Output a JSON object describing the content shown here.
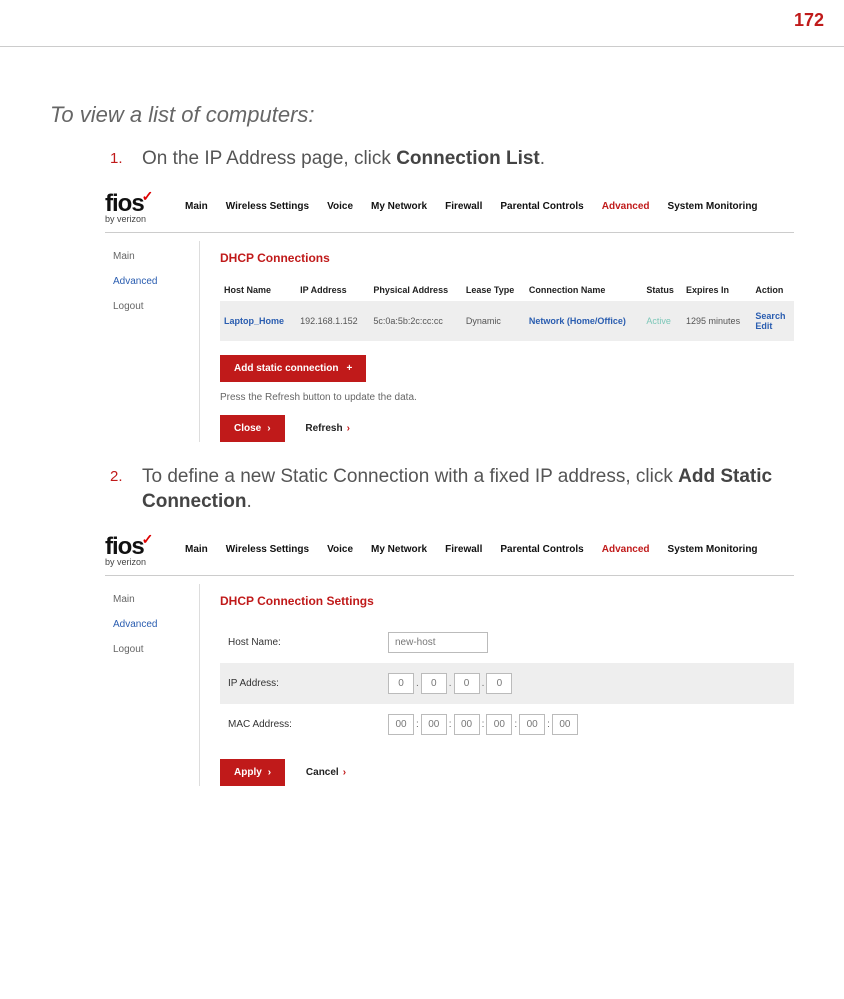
{
  "page_number": "172",
  "section_title": "To view a list of computers:",
  "step1": {
    "num": "1.",
    "text_prefix": "On the IP Address page, click ",
    "text_bold": "Connection List",
    "text_suffix": "."
  },
  "step2": {
    "num": "2.",
    "text_prefix": "To define a new Static Connection with a fixed IP address, click ",
    "text_bold": "Add Static Connection",
    "text_suffix": "."
  },
  "fios": {
    "logo_word": "fios",
    "logo_check": "✓",
    "by": "by verizon",
    "nav": [
      "Main",
      "Wireless Settings",
      "Voice",
      "My Network",
      "Firewall",
      "Parental Controls",
      "Advanced",
      "System Monitoring"
    ],
    "nav_active": "Advanced",
    "sidebar": [
      "Main",
      "Advanced",
      "Logout"
    ],
    "sidebar_active": "Advanced"
  },
  "shot1": {
    "title": "DHCP Connections",
    "headers": [
      "Host Name",
      "IP Address",
      "Physical Address",
      "Lease Type",
      "Connection Name",
      "Status",
      "Expires In",
      "Action"
    ],
    "row": {
      "host": "Laptop_Home",
      "ip": "192.168.1.152",
      "phys": "5c:0a:5b:2c:cc:cc",
      "lease": "Dynamic",
      "conn": "Network (Home/Office)",
      "status": "Active",
      "expires": "1295 minutes",
      "action1": "Search",
      "action2": "Edit"
    },
    "add_btn": "Add static connection",
    "hint": "Press the Refresh button to update the data.",
    "close": "Close",
    "refresh": "Refresh"
  },
  "shot2": {
    "title": "DHCP Connection Settings",
    "host_label": "Host Name:",
    "host_value": "new-host",
    "ip_label": "IP Address:",
    "ip_oct": [
      "0",
      "0",
      "0",
      "0"
    ],
    "mac_label": "MAC Address:",
    "mac_oct": [
      "00",
      "00",
      "00",
      "00",
      "00",
      "00"
    ],
    "apply": "Apply",
    "cancel": "Cancel"
  }
}
